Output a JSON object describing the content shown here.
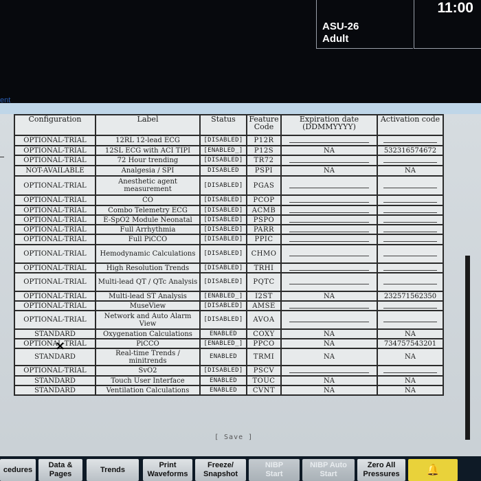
{
  "header": {
    "bed": "ASU-26",
    "patient_category": "Adult",
    "time": "11:00"
  },
  "left_fragment": "ent",
  "table": {
    "columns": [
      "Configuration",
      "Label",
      "Status",
      "Feature\nCode",
      "Expiration date\n(DDMMYYYY)",
      "Activation code"
    ],
    "rows": [
      {
        "config": "OPTIONAL-TRIAL",
        "label": "12RL 12-lead ECG",
        "status": "[DISABLED]",
        "code": "P12R",
        "exp": "",
        "act": ""
      },
      {
        "config": "OPTIONAL-TRIAL",
        "label": "12SL ECG with ACI TIPI",
        "status": "[ENABLED_]",
        "code": "P12S",
        "exp": "NA",
        "act": "532316574672"
      },
      {
        "config": "OPTIONAL-TRIAL",
        "label": "72 Hour trending",
        "status": "[DISABLED]",
        "code": "TR72",
        "exp": "",
        "act": ""
      },
      {
        "config": "NOT-AVAILABLE",
        "label": "Analgesia / SPI",
        "status": "DISABLED",
        "code": "PSPI",
        "exp": "NA",
        "act": "NA"
      },
      {
        "config": "OPTIONAL-TRIAL",
        "label": "Anesthetic agent measurement",
        "status": "[DISABLED]",
        "code": "PGAS",
        "exp": "",
        "act": ""
      },
      {
        "config": "OPTIONAL-TRIAL",
        "label": "CO",
        "status": "[DISABLED]",
        "code": "PCOP",
        "exp": "",
        "act": ""
      },
      {
        "config": "OPTIONAL-TRIAL",
        "label": "Combo Telemetry ECG",
        "status": "[DISABLED]",
        "code": "ACMB",
        "exp": "",
        "act": ""
      },
      {
        "config": "OPTIONAL-TRIAL",
        "label": "E-SpO2 Module Neonatal",
        "status": "[DISABLED]",
        "code": "PSPO",
        "exp": "",
        "act": ""
      },
      {
        "config": "OPTIONAL-TRIAL",
        "label": "Full Arrhythmia",
        "status": "[DISABLED]",
        "code": "PARR",
        "exp": "",
        "act": ""
      },
      {
        "config": "OPTIONAL-TRIAL",
        "label": "Full PiCCO",
        "status": "[DISABLED]",
        "code": "PPIC",
        "exp": "",
        "act": ""
      },
      {
        "config": "OPTIONAL-TRIAL",
        "label": "Hemodynamic Calculations",
        "status": "[DISABLED]",
        "code": "CHMO",
        "exp": "",
        "act": ""
      },
      {
        "config": "OPTIONAL-TRIAL",
        "label": "High Resolution Trends",
        "status": "[DISABLED]",
        "code": "TRHI",
        "exp": "",
        "act": ""
      },
      {
        "config": "OPTIONAL-TRIAL",
        "label": "Multi-lead QT / QTc Analysis",
        "status": "[DISABLED]",
        "code": "PQTC",
        "exp": "",
        "act": ""
      },
      {
        "config": "OPTIONAL-TRIAL",
        "label": "Multi-lead ST Analysis",
        "status": "[ENABLED_]",
        "code": "I2ST",
        "exp": "NA",
        "act": "232571562350"
      },
      {
        "config": "OPTIONAL-TRIAL",
        "label": "MuseView",
        "status": "[DISABLED]",
        "code": "AMSE",
        "exp": "",
        "act": ""
      },
      {
        "config": "OPTIONAL-TRIAL",
        "label": "Network and Auto Alarm View",
        "status": "[DISABLED]",
        "code": "AVOA",
        "exp": "",
        "act": ""
      },
      {
        "config": "STANDARD",
        "label": "Oxygenation Calculations",
        "status": "ENABLED",
        "code": "COXY",
        "exp": "NA",
        "act": "NA"
      },
      {
        "config": "OPTIONAL-TRIAL",
        "label": "PiCCO",
        "status": "[ENABLED_]",
        "code": "PPCO",
        "exp": "NA",
        "act": "734757543201"
      },
      {
        "config": "STANDARD",
        "label": "Real-time Trends / minitrends",
        "status": "ENABLED",
        "code": "TRMI",
        "exp": "NA",
        "act": "NA"
      },
      {
        "config": "OPTIONAL-TRIAL",
        "label": "SvO2",
        "status": "[DISABLED]",
        "code": "PSCV",
        "exp": "",
        "act": ""
      },
      {
        "config": "STANDARD",
        "label": "Touch User Interface",
        "status": "ENABLED",
        "code": "TOUC",
        "exp": "NA",
        "act": "NA"
      },
      {
        "config": "STANDARD",
        "label": "Ventilation Calculations",
        "status": "ENABLED",
        "code": "CVNT",
        "exp": "NA",
        "act": "NA"
      }
    ]
  },
  "save_label": "[ Save ]",
  "x_mark": "×",
  "soft_keys": [
    {
      "label": "cedures",
      "state": "normal"
    },
    {
      "label": "Data &\nPages",
      "state": "normal"
    },
    {
      "label": "Trends",
      "state": "normal"
    },
    {
      "label": "Print\nWaveforms",
      "state": "normal"
    },
    {
      "label": "Freeze/\nSnapshot",
      "state": "normal"
    },
    {
      "label": "NIBP\nStart",
      "state": "disabled"
    },
    {
      "label": "NIBP Auto\nStart",
      "state": "disabled"
    },
    {
      "label": "Zero All\nPressures",
      "state": "normal"
    },
    {
      "label": "",
      "state": "alarm"
    }
  ],
  "colors": {
    "screen_bg": "#d6dce0",
    "alarm_key": "#e9d23a",
    "link": "#2a5db0"
  }
}
